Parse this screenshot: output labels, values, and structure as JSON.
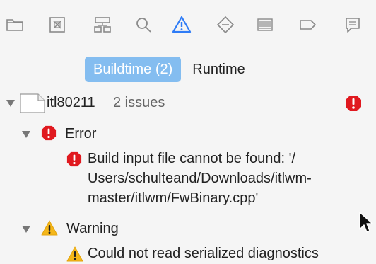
{
  "toolbar": {
    "icons": [
      "folder-icon",
      "source-control-icon",
      "hierarchy-icon",
      "search-icon",
      "issue-warning-icon",
      "test-diamond-icon",
      "debug-list-icon",
      "breakpoint-tag-icon",
      "report-chat-icon"
    ],
    "active_icon": "issue-warning-icon",
    "active_color": "#2f7cf6"
  },
  "segmented": {
    "buildtime_label": "Buildtime (2)",
    "runtime_label": "Runtime"
  },
  "issues": {
    "project_name": "itl80211",
    "project_count": "2 issues",
    "error_group_label": "Error",
    "error_message_lines": [
      "Build input file cannot be found: '/",
      "Users/schulteand/Downloads/itlwm-",
      "master/itlwm/FwBinary.cpp'"
    ],
    "warning_group_label": "Warning",
    "warning_message_lines": [
      "Could not read serialized diagnostics"
    ]
  },
  "colors": {
    "error_red": "#e0191f",
    "warning_yellow": "#f5b71a",
    "selection_blue": "#84bdf0"
  }
}
